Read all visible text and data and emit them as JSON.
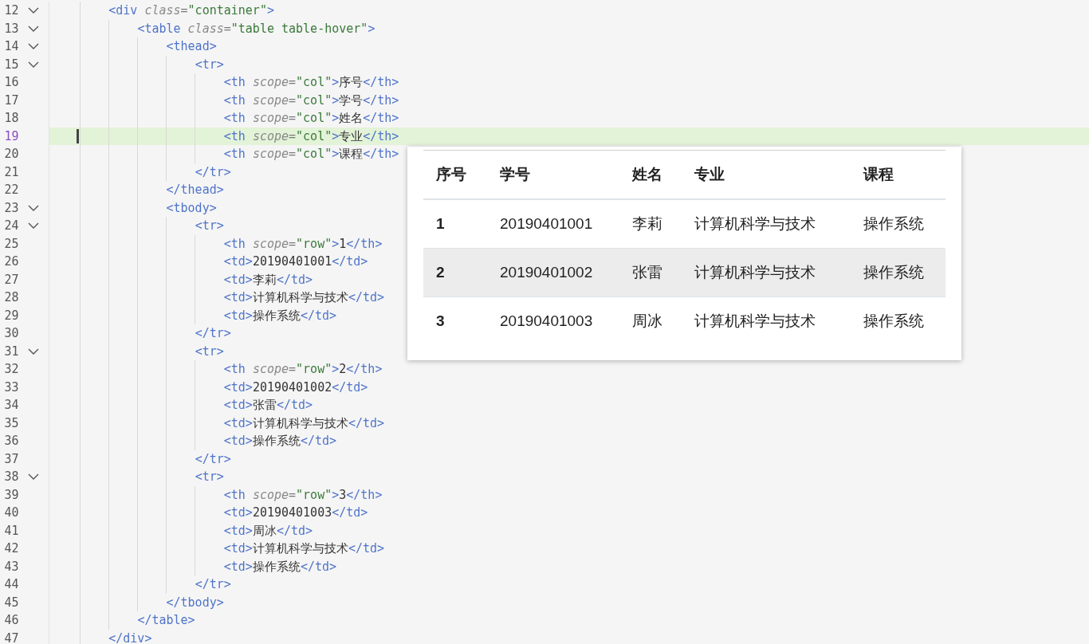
{
  "editor": {
    "lines": [
      {
        "number": "12",
        "fold": true,
        "current": false,
        "tokens": [
          {
            "kind": "tag",
            "text": "        <div "
          },
          {
            "kind": "attr",
            "text": "class"
          },
          {
            "kind": "punct",
            "text": "="
          },
          {
            "kind": "string",
            "text": "\"container\""
          },
          {
            "kind": "tag",
            "text": ">"
          }
        ]
      },
      {
        "number": "13",
        "fold": true,
        "current": false,
        "tokens": [
          {
            "kind": "tag",
            "text": "            <table "
          },
          {
            "kind": "attr",
            "text": "class"
          },
          {
            "kind": "punct",
            "text": "="
          },
          {
            "kind": "string",
            "text": "\"table table-hover\""
          },
          {
            "kind": "tag",
            "text": ">"
          }
        ]
      },
      {
        "number": "14",
        "fold": true,
        "current": false,
        "tokens": [
          {
            "kind": "tag",
            "text": "                <thead>"
          }
        ]
      },
      {
        "number": "15",
        "fold": true,
        "current": false,
        "tokens": [
          {
            "kind": "tag",
            "text": "                    <tr>"
          }
        ]
      },
      {
        "number": "16",
        "fold": false,
        "current": false,
        "tokens": [
          {
            "kind": "tag",
            "text": "                        <th "
          },
          {
            "kind": "attr",
            "text": "scope"
          },
          {
            "kind": "punct",
            "text": "="
          },
          {
            "kind": "string",
            "text": "\"col\""
          },
          {
            "kind": "tag",
            "text": ">"
          },
          {
            "kind": "text",
            "text": "序号"
          },
          {
            "kind": "tag",
            "text": "</th>"
          }
        ]
      },
      {
        "number": "17",
        "fold": false,
        "current": false,
        "tokens": [
          {
            "kind": "tag",
            "text": "                        <th "
          },
          {
            "kind": "attr",
            "text": "scope"
          },
          {
            "kind": "punct",
            "text": "="
          },
          {
            "kind": "string",
            "text": "\"col\""
          },
          {
            "kind": "tag",
            "text": ">"
          },
          {
            "kind": "text",
            "text": "学号"
          },
          {
            "kind": "tag",
            "text": "</th>"
          }
        ]
      },
      {
        "number": "18",
        "fold": false,
        "current": false,
        "tokens": [
          {
            "kind": "tag",
            "text": "                        <th "
          },
          {
            "kind": "attr",
            "text": "scope"
          },
          {
            "kind": "punct",
            "text": "="
          },
          {
            "kind": "string",
            "text": "\"col\""
          },
          {
            "kind": "tag",
            "text": ">"
          },
          {
            "kind": "text",
            "text": "姓名"
          },
          {
            "kind": "tag",
            "text": "</th>"
          }
        ]
      },
      {
        "number": "19",
        "fold": false,
        "current": true,
        "tokens": [
          {
            "kind": "tag",
            "text": "                        <th "
          },
          {
            "kind": "attr",
            "text": "scope"
          },
          {
            "kind": "punct",
            "text": "="
          },
          {
            "kind": "string",
            "text": "\"col\""
          },
          {
            "kind": "tag",
            "text": ">"
          },
          {
            "kind": "text",
            "text": "专业"
          },
          {
            "kind": "tag",
            "text": "</th>"
          }
        ]
      },
      {
        "number": "20",
        "fold": false,
        "current": false,
        "tokens": [
          {
            "kind": "tag",
            "text": "                        <th "
          },
          {
            "kind": "attr",
            "text": "scope"
          },
          {
            "kind": "punct",
            "text": "="
          },
          {
            "kind": "string",
            "text": "\"col\""
          },
          {
            "kind": "tag",
            "text": ">"
          },
          {
            "kind": "text",
            "text": "课程"
          },
          {
            "kind": "tag",
            "text": "</th>"
          }
        ]
      },
      {
        "number": "21",
        "fold": false,
        "current": false,
        "tokens": [
          {
            "kind": "tag",
            "text": "                    </tr>"
          }
        ]
      },
      {
        "number": "22",
        "fold": false,
        "current": false,
        "tokens": [
          {
            "kind": "tag",
            "text": "                </thead>"
          }
        ]
      },
      {
        "number": "23",
        "fold": true,
        "current": false,
        "tokens": [
          {
            "kind": "tag",
            "text": "                <tbody>"
          }
        ]
      },
      {
        "number": "24",
        "fold": true,
        "current": false,
        "tokens": [
          {
            "kind": "tag",
            "text": "                    <tr>"
          }
        ]
      },
      {
        "number": "25",
        "fold": false,
        "current": false,
        "tokens": [
          {
            "kind": "tag",
            "text": "                        <th "
          },
          {
            "kind": "attr",
            "text": "scope"
          },
          {
            "kind": "punct",
            "text": "="
          },
          {
            "kind": "string",
            "text": "\"row\""
          },
          {
            "kind": "tag",
            "text": ">"
          },
          {
            "kind": "text",
            "text": "1"
          },
          {
            "kind": "tag",
            "text": "</th>"
          }
        ]
      },
      {
        "number": "26",
        "fold": false,
        "current": false,
        "tokens": [
          {
            "kind": "tag",
            "text": "                        <td>"
          },
          {
            "kind": "text",
            "text": "20190401001"
          },
          {
            "kind": "tag",
            "text": "</td>"
          }
        ]
      },
      {
        "number": "27",
        "fold": false,
        "current": false,
        "tokens": [
          {
            "kind": "tag",
            "text": "                        <td>"
          },
          {
            "kind": "text",
            "text": "李莉"
          },
          {
            "kind": "tag",
            "text": "</td>"
          }
        ]
      },
      {
        "number": "28",
        "fold": false,
        "current": false,
        "tokens": [
          {
            "kind": "tag",
            "text": "                        <td>"
          },
          {
            "kind": "text",
            "text": "计算机科学与技术"
          },
          {
            "kind": "tag",
            "text": "</td>"
          }
        ]
      },
      {
        "number": "29",
        "fold": false,
        "current": false,
        "tokens": [
          {
            "kind": "tag",
            "text": "                        <td>"
          },
          {
            "kind": "text",
            "text": "操作系统"
          },
          {
            "kind": "tag",
            "text": "</td>"
          }
        ]
      },
      {
        "number": "30",
        "fold": false,
        "current": false,
        "tokens": [
          {
            "kind": "tag",
            "text": "                    </tr>"
          }
        ]
      },
      {
        "number": "31",
        "fold": true,
        "current": false,
        "tokens": [
          {
            "kind": "tag",
            "text": "                    <tr>"
          }
        ]
      },
      {
        "number": "32",
        "fold": false,
        "current": false,
        "tokens": [
          {
            "kind": "tag",
            "text": "                        <th "
          },
          {
            "kind": "attr",
            "text": "scope"
          },
          {
            "kind": "punct",
            "text": "="
          },
          {
            "kind": "string",
            "text": "\"row\""
          },
          {
            "kind": "tag",
            "text": ">"
          },
          {
            "kind": "text",
            "text": "2"
          },
          {
            "kind": "tag",
            "text": "</th>"
          }
        ]
      },
      {
        "number": "33",
        "fold": false,
        "current": false,
        "tokens": [
          {
            "kind": "tag",
            "text": "                        <td>"
          },
          {
            "kind": "text",
            "text": "20190401002"
          },
          {
            "kind": "tag",
            "text": "</td>"
          }
        ]
      },
      {
        "number": "34",
        "fold": false,
        "current": false,
        "tokens": [
          {
            "kind": "tag",
            "text": "                        <td>"
          },
          {
            "kind": "text",
            "text": "张雷"
          },
          {
            "kind": "tag",
            "text": "</td>"
          }
        ]
      },
      {
        "number": "35",
        "fold": false,
        "current": false,
        "tokens": [
          {
            "kind": "tag",
            "text": "                        <td>"
          },
          {
            "kind": "text",
            "text": "计算机科学与技术"
          },
          {
            "kind": "tag",
            "text": "</td>"
          }
        ]
      },
      {
        "number": "36",
        "fold": false,
        "current": false,
        "tokens": [
          {
            "kind": "tag",
            "text": "                        <td>"
          },
          {
            "kind": "text",
            "text": "操作系统"
          },
          {
            "kind": "tag",
            "text": "</td>"
          }
        ]
      },
      {
        "number": "37",
        "fold": false,
        "current": false,
        "tokens": [
          {
            "kind": "tag",
            "text": "                    </tr>"
          }
        ]
      },
      {
        "number": "38",
        "fold": true,
        "current": false,
        "tokens": [
          {
            "kind": "tag",
            "text": "                    <tr>"
          }
        ]
      },
      {
        "number": "39",
        "fold": false,
        "current": false,
        "tokens": [
          {
            "kind": "tag",
            "text": "                        <th "
          },
          {
            "kind": "attr",
            "text": "scope"
          },
          {
            "kind": "punct",
            "text": "="
          },
          {
            "kind": "string",
            "text": "\"row\""
          },
          {
            "kind": "tag",
            "text": ">"
          },
          {
            "kind": "text",
            "text": "3"
          },
          {
            "kind": "tag",
            "text": "</th>"
          }
        ]
      },
      {
        "number": "40",
        "fold": false,
        "current": false,
        "tokens": [
          {
            "kind": "tag",
            "text": "                        <td>"
          },
          {
            "kind": "text",
            "text": "20190401003"
          },
          {
            "kind": "tag",
            "text": "</td>"
          }
        ]
      },
      {
        "number": "41",
        "fold": false,
        "current": false,
        "tokens": [
          {
            "kind": "tag",
            "text": "                        <td>"
          },
          {
            "kind": "text",
            "text": "周冰"
          },
          {
            "kind": "tag",
            "text": "</td>"
          }
        ]
      },
      {
        "number": "42",
        "fold": false,
        "current": false,
        "tokens": [
          {
            "kind": "tag",
            "text": "                        <td>"
          },
          {
            "kind": "text",
            "text": "计算机科学与技术"
          },
          {
            "kind": "tag",
            "text": "</td>"
          }
        ]
      },
      {
        "number": "43",
        "fold": false,
        "current": false,
        "tokens": [
          {
            "kind": "tag",
            "text": "                        <td>"
          },
          {
            "kind": "text",
            "text": "操作系统"
          },
          {
            "kind": "tag",
            "text": "</td>"
          }
        ]
      },
      {
        "number": "44",
        "fold": false,
        "current": false,
        "tokens": [
          {
            "kind": "tag",
            "text": "                    </tr>"
          }
        ]
      },
      {
        "number": "45",
        "fold": false,
        "current": false,
        "tokens": [
          {
            "kind": "tag",
            "text": "                </tbody>"
          }
        ]
      },
      {
        "number": "46",
        "fold": false,
        "current": false,
        "tokens": [
          {
            "kind": "tag",
            "text": "            </table>"
          }
        ]
      },
      {
        "number": "47",
        "fold": false,
        "current": false,
        "tokens": [
          {
            "kind": "tag",
            "text": "        </div>"
          }
        ]
      }
    ]
  },
  "preview": {
    "table": {
      "columns": [
        "序号",
        "学号",
        "姓名",
        "专业",
        "课程"
      ],
      "rows": [
        {
          "hovered": false,
          "cells": [
            "1",
            "20190401001",
            "李莉",
            "计算机科学与技术",
            "操作系统"
          ]
        },
        {
          "hovered": true,
          "cells": [
            "2",
            "20190401002",
            "张雷",
            "计算机科学与技术",
            "操作系统"
          ]
        },
        {
          "hovered": false,
          "cells": [
            "3",
            "20190401003",
            "周冰",
            "计算机科学与技术",
            "操作系统"
          ]
        }
      ]
    }
  }
}
